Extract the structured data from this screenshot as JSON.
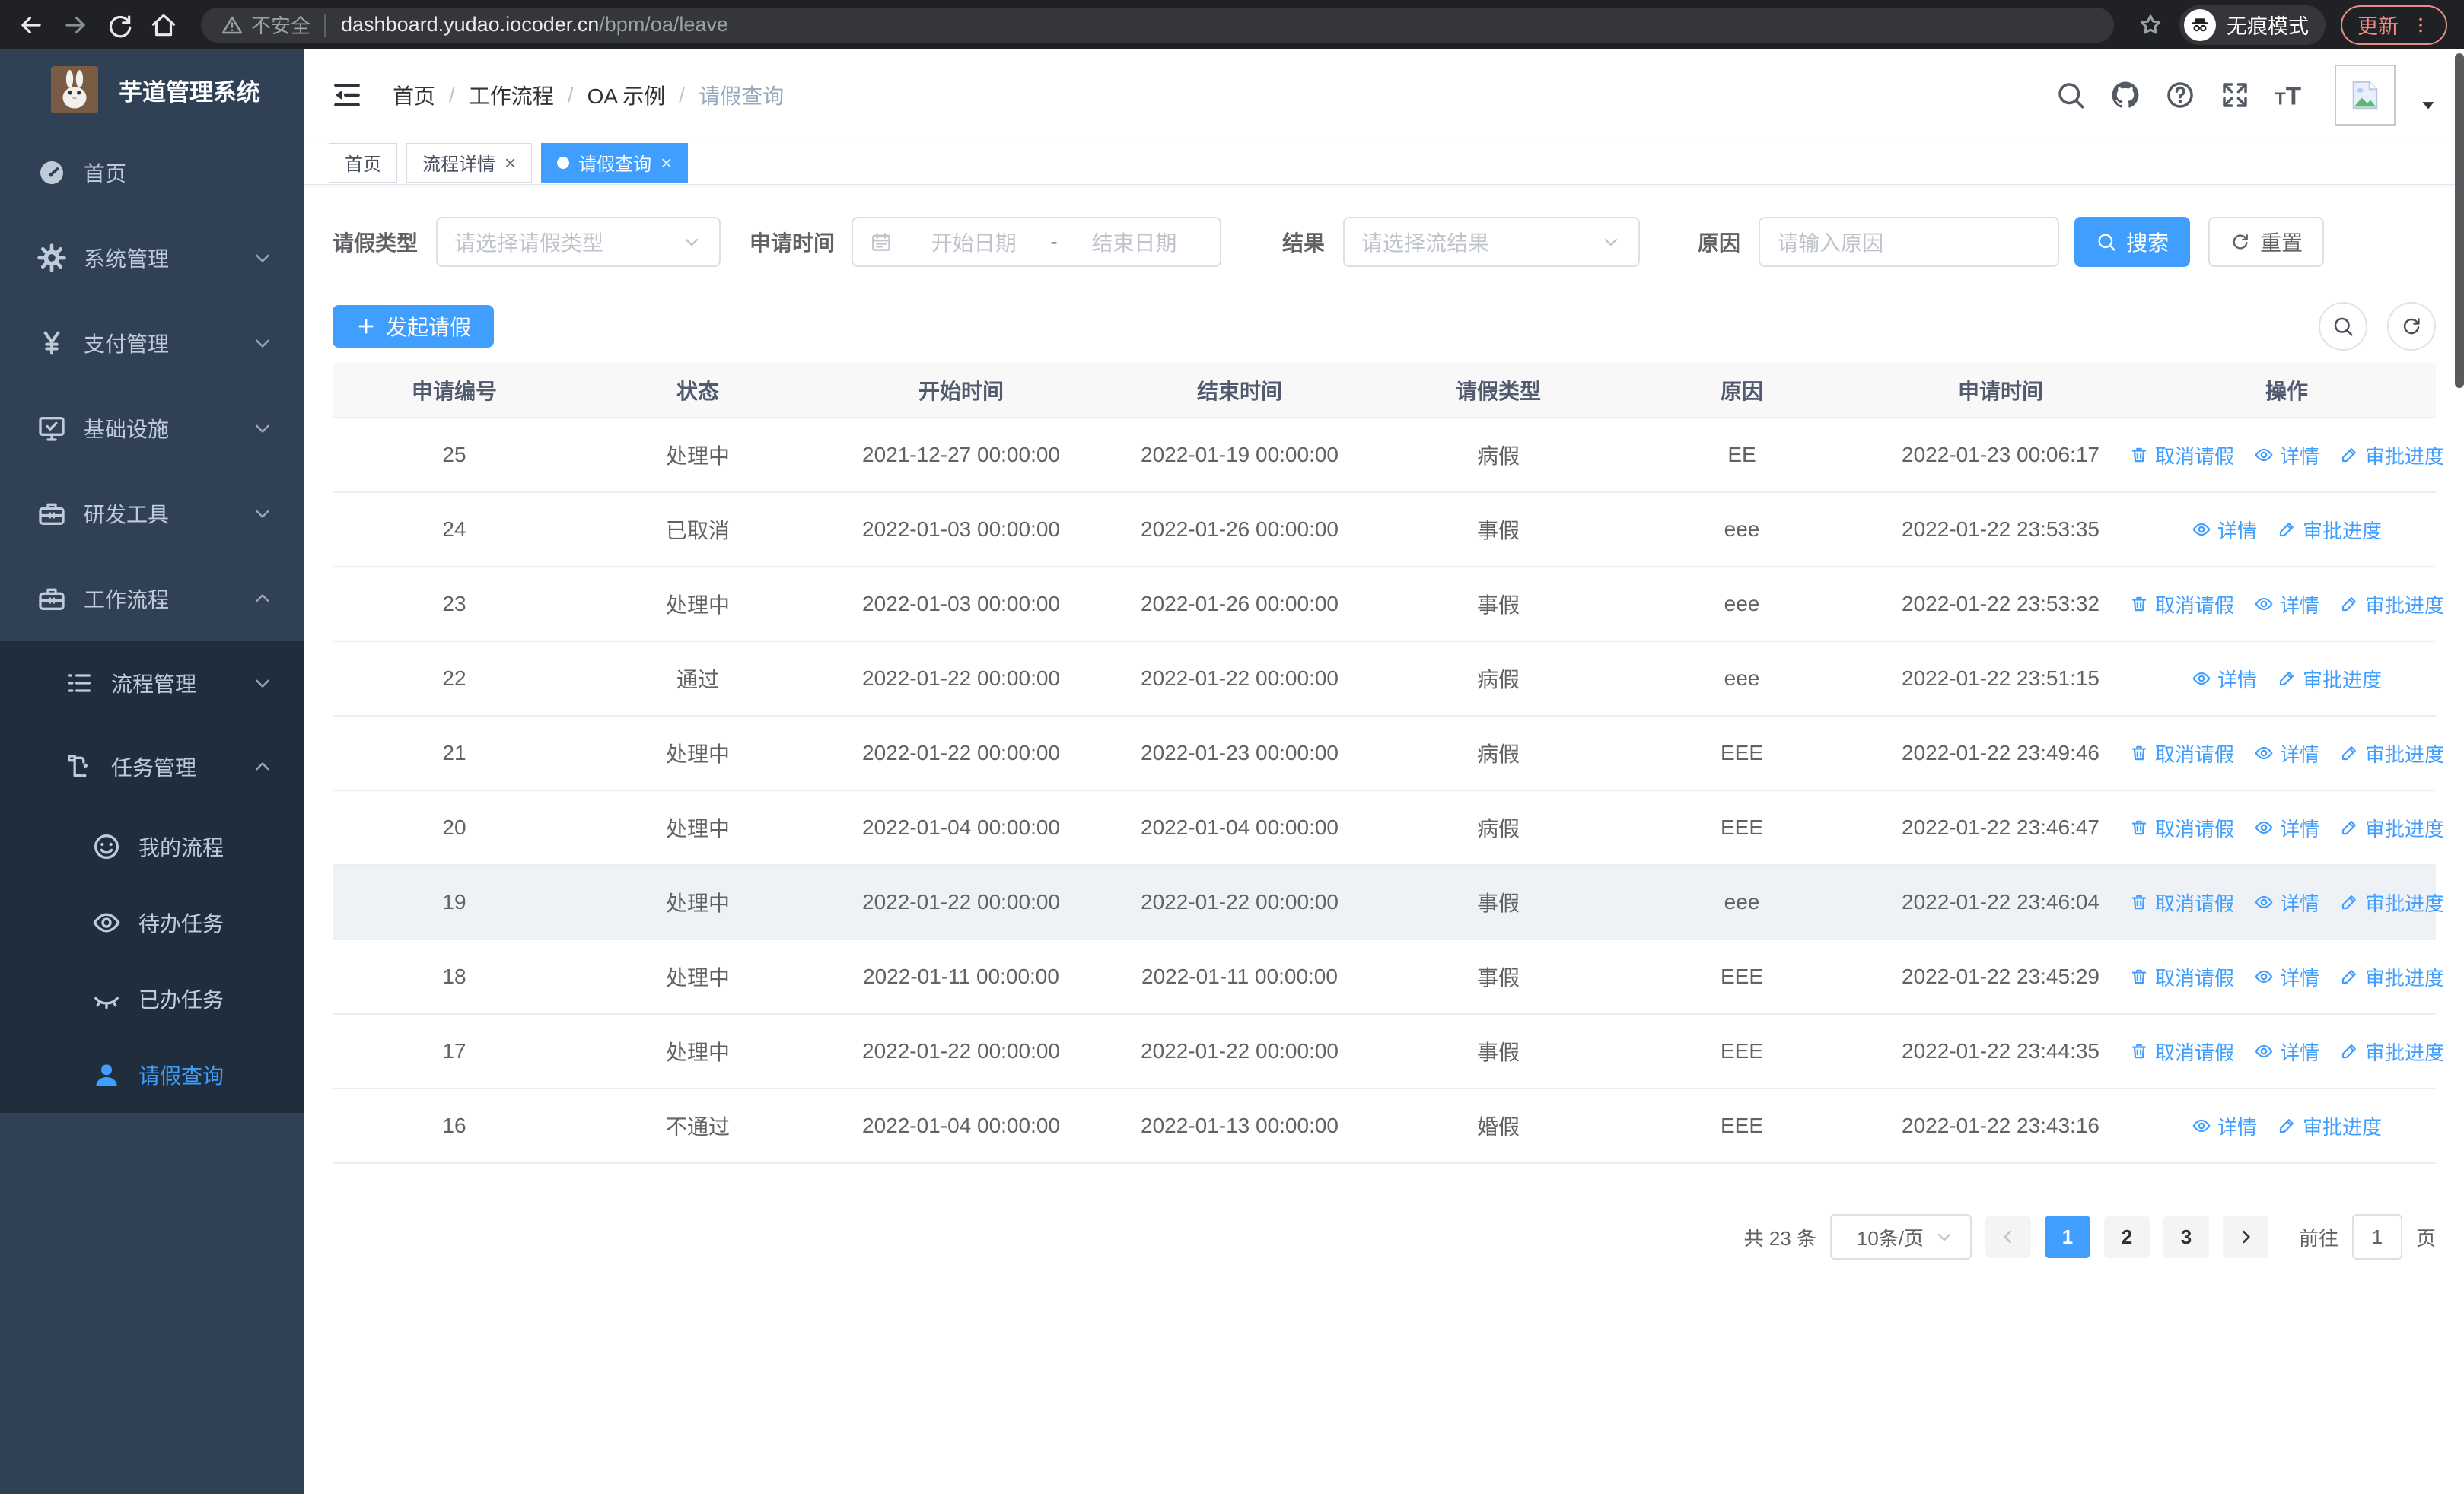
{
  "colors": {
    "accent": "#409eff",
    "sidebar_bg": "#304156",
    "sidebar_sub_bg": "#1f2d3d",
    "chrome_bg": "#202124"
  },
  "browser": {
    "security_label": "不安全",
    "url_host": "dashboard.yudao.iocoder.cn",
    "url_path": "/bpm/oa/leave",
    "incognito_label": "无痕模式",
    "update_label": "更新"
  },
  "sidebar": {
    "app_title": "芋道管理系统",
    "items": [
      {
        "label": "首页",
        "icon": "dashboard-icon",
        "level": 1
      },
      {
        "label": "系统管理",
        "icon": "gear-icon",
        "level": 1,
        "chevron": "down"
      },
      {
        "label": "支付管理",
        "icon": "yen-icon",
        "level": 1,
        "chevron": "down"
      },
      {
        "label": "基础设施",
        "icon": "monitor-icon",
        "level": 1,
        "chevron": "down"
      },
      {
        "label": "研发工具",
        "icon": "toolbox-icon",
        "level": 1,
        "chevron": "down"
      },
      {
        "label": "工作流程",
        "icon": "toolbox-icon",
        "level": 1,
        "chevron": "up"
      },
      {
        "label": "流程管理",
        "icon": "list-icon",
        "level": 2,
        "chevron": "down",
        "dark": true
      },
      {
        "label": "任务管理",
        "icon": "flow-icon",
        "level": 2,
        "chevron": "up",
        "dark": true
      },
      {
        "label": "我的流程",
        "icon": "face-icon",
        "level": 3,
        "dark": true
      },
      {
        "label": "待办任务",
        "icon": "eye-icon",
        "level": 3,
        "dark": true
      },
      {
        "label": "已办任务",
        "icon": "eye-closed-icon",
        "level": 3,
        "dark": true
      },
      {
        "label": "请假查询",
        "icon": "user-icon",
        "level": 3,
        "dark": true,
        "active": true
      }
    ]
  },
  "header": {
    "breadcrumb": [
      "首页",
      "工作流程",
      "OA 示例",
      "请假查询"
    ],
    "separator": "/"
  },
  "tabs": [
    {
      "label": "首页"
    },
    {
      "label": "流程详情",
      "closable": true
    },
    {
      "label": "请假查询",
      "closable": true,
      "active": true
    }
  ],
  "filters": {
    "leave_type": {
      "label": "请假类型",
      "placeholder": "请选择请假类型"
    },
    "apply_time": {
      "label": "申请时间",
      "start_placeholder": "开始日期",
      "separator": "-",
      "end_placeholder": "结束日期"
    },
    "result": {
      "label": "结果",
      "placeholder": "请选择流结果"
    },
    "reason": {
      "label": "原因",
      "placeholder": "请输入原因"
    },
    "search_label": "搜索",
    "reset_label": "重置"
  },
  "toolbar": {
    "create_label": "发起请假"
  },
  "table": {
    "columns": [
      "申请编号",
      "状态",
      "开始时间",
      "结束时间",
      "请假类型",
      "原因",
      "申请时间",
      "操作"
    ],
    "action_defs": {
      "cancel": {
        "label": "取消请假",
        "icon": "trash-icon"
      },
      "detail": {
        "label": "详情",
        "icon": "eye-icon"
      },
      "progress": {
        "label": "审批进度",
        "icon": "edit-icon"
      }
    },
    "rows": [
      {
        "id": "25",
        "status": "处理中",
        "start": "2021-12-27 00:00:00",
        "end": "2022-01-19 00:00:00",
        "type": "病假",
        "reason": "EE",
        "apply_time": "2022-01-23 00:06:17",
        "actions": [
          "cancel",
          "detail",
          "progress"
        ]
      },
      {
        "id": "24",
        "status": "已取消",
        "start": "2022-01-03 00:00:00",
        "end": "2022-01-26 00:00:00",
        "type": "事假",
        "reason": "eee",
        "apply_time": "2022-01-22 23:53:35",
        "actions": [
          "detail",
          "progress"
        ]
      },
      {
        "id": "23",
        "status": "处理中",
        "start": "2022-01-03 00:00:00",
        "end": "2022-01-26 00:00:00",
        "type": "事假",
        "reason": "eee",
        "apply_time": "2022-01-22 23:53:32",
        "actions": [
          "cancel",
          "detail",
          "progress"
        ]
      },
      {
        "id": "22",
        "status": "通过",
        "start": "2022-01-22 00:00:00",
        "end": "2022-01-22 00:00:00",
        "type": "病假",
        "reason": "eee",
        "apply_time": "2022-01-22 23:51:15",
        "actions": [
          "detail",
          "progress"
        ]
      },
      {
        "id": "21",
        "status": "处理中",
        "start": "2022-01-22 00:00:00",
        "end": "2022-01-23 00:00:00",
        "type": "病假",
        "reason": "EEE",
        "apply_time": "2022-01-22 23:49:46",
        "actions": [
          "cancel",
          "detail",
          "progress"
        ]
      },
      {
        "id": "20",
        "status": "处理中",
        "start": "2022-01-04 00:00:00",
        "end": "2022-01-04 00:00:00",
        "type": "病假",
        "reason": "EEE",
        "apply_time": "2022-01-22 23:46:47",
        "actions": [
          "cancel",
          "detail",
          "progress"
        ]
      },
      {
        "id": "19",
        "status": "处理中",
        "start": "2022-01-22 00:00:00",
        "end": "2022-01-22 00:00:00",
        "type": "事假",
        "reason": "eee",
        "apply_time": "2022-01-22 23:46:04",
        "hover": true,
        "actions": [
          "cancel",
          "detail",
          "progress"
        ]
      },
      {
        "id": "18",
        "status": "处理中",
        "start": "2022-01-11 00:00:00",
        "end": "2022-01-11 00:00:00",
        "type": "事假",
        "reason": "EEE",
        "apply_time": "2022-01-22 23:45:29",
        "actions": [
          "cancel",
          "detail",
          "progress"
        ]
      },
      {
        "id": "17",
        "status": "处理中",
        "start": "2022-01-22 00:00:00",
        "end": "2022-01-22 00:00:00",
        "type": "事假",
        "reason": "EEE",
        "apply_time": "2022-01-22 23:44:35",
        "actions": [
          "cancel",
          "detail",
          "progress"
        ]
      },
      {
        "id": "16",
        "status": "不通过",
        "start": "2022-01-04 00:00:00",
        "end": "2022-01-13 00:00:00",
        "type": "婚假",
        "reason": "EEE",
        "apply_time": "2022-01-22 23:43:16",
        "actions": [
          "detail",
          "progress"
        ]
      }
    ]
  },
  "pagination": {
    "total_label": "共 23 条",
    "page_size_label": "10条/页",
    "pages": [
      {
        "label": "1",
        "active": true
      },
      {
        "label": "2"
      },
      {
        "label": "3"
      }
    ],
    "jump_prefix": "前往",
    "jump_value": "1",
    "jump_suffix": "页"
  }
}
